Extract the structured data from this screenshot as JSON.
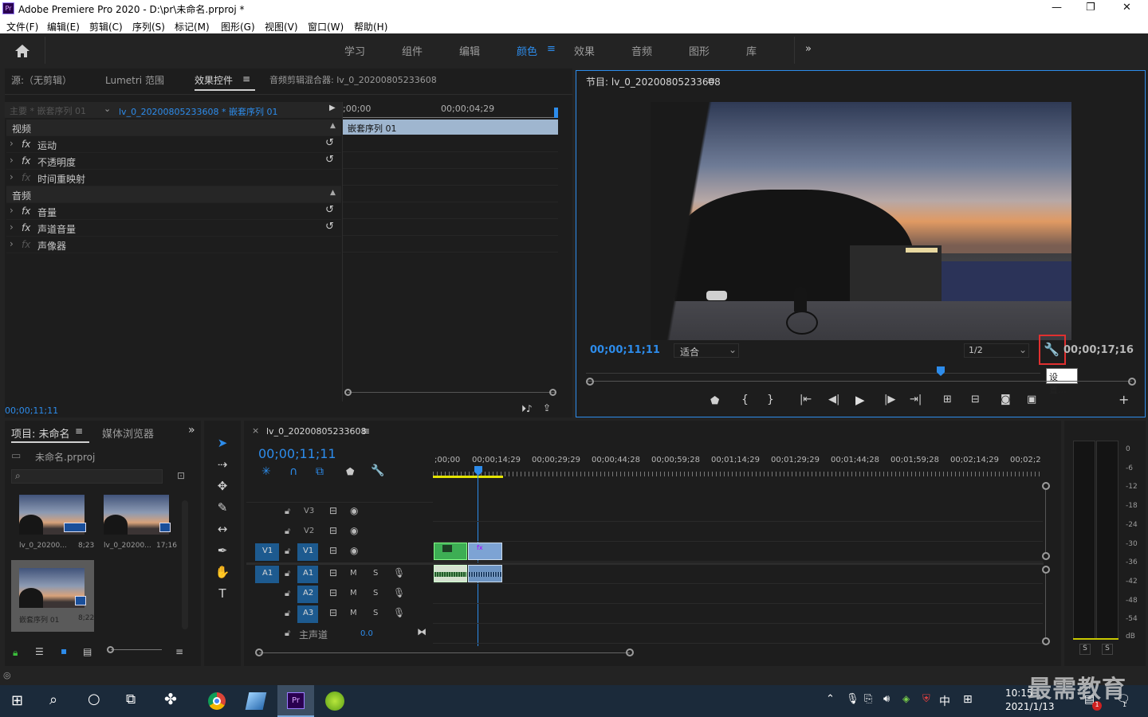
{
  "window": {
    "title": "Adobe Premiere Pro 2020 - D:\\pr\\未命名.prproj *",
    "logo": "Pr",
    "minimize": "—",
    "maximize": "❐",
    "close": "✕"
  },
  "menu": [
    "文件(F)",
    "编辑(E)",
    "剪辑(C)",
    "序列(S)",
    "标记(M)",
    "图形(G)",
    "视图(V)",
    "窗口(W)",
    "帮助(H)"
  ],
  "workspaces": [
    "学习",
    "组件",
    "编辑",
    "颜色",
    "效果",
    "音频",
    "图形",
    "库"
  ],
  "workspace_active": "颜色",
  "source_panel": {
    "tabs": [
      "源:（无剪辑）",
      "Lumetri 范围",
      "效果控件",
      "音频剪辑混合器: lv_0_20200805233608"
    ],
    "active_tab": "效果控件",
    "master": "主要 * 嵌套序列 01",
    "sequence": "lv_0_20200805233608 * 嵌套序列 01",
    "time_start": ";00;00",
    "time_mid": "00;00;04;29",
    "clip_label": "嵌套序列 01",
    "sections": {
      "video": "视频",
      "audio": "音频"
    },
    "video_effects": [
      "运动",
      "不透明度",
      "时间重映射"
    ],
    "audio_effects": [
      "音量",
      "声道音量",
      "声像器"
    ],
    "fx": "fx",
    "timecode": "00;00;11;11"
  },
  "program": {
    "title": "节目: lv_0_20200805233608",
    "timecode": "00;00;11;11",
    "fit": "适合",
    "resolution": "1/2",
    "duration": "00;00;17;16",
    "tooltip": "设置..."
  },
  "project": {
    "tabs": [
      "项目: 未命名",
      "媒体浏览器"
    ],
    "file": "未命名.prproj",
    "items": [
      {
        "name": "lv_0_20200...",
        "duration": "8;23"
      },
      {
        "name": "lv_0_20200...",
        "duration": "17;16"
      },
      {
        "name": "嵌套序列 01",
        "duration": "8;22"
      }
    ]
  },
  "timeline": {
    "title": "lv_0_20200805233608",
    "timecode": "00;00;11;11",
    "ruler": [
      ";00;00",
      "00;00;14;29",
      "00;00;29;29",
      "00;00;44;28",
      "00;00;59;28",
      "00;01;14;29",
      "00;01;29;29",
      "00;01;44;28",
      "00;01;59;28",
      "00;02;14;29",
      "00;02;2"
    ],
    "video_tracks": [
      "V3",
      "V2",
      "V1"
    ],
    "audio_tracks": [
      "A1",
      "A2",
      "A3"
    ],
    "source_v": "V1",
    "source_a": "A1",
    "master": "主声道",
    "master_value": "0.0",
    "m": "M",
    "s": "S"
  },
  "meter": {
    "scale": [
      "0",
      "-6",
      "-12",
      "-18",
      "-24",
      "-30",
      "-36",
      "-42",
      "-48",
      "-54",
      "dB"
    ],
    "solo": [
      "S",
      "S"
    ]
  },
  "taskbar": {
    "ime": "中",
    "time": "10:15",
    "date": "2021/1/13",
    "notif": "1"
  },
  "watermark": "最需教育"
}
